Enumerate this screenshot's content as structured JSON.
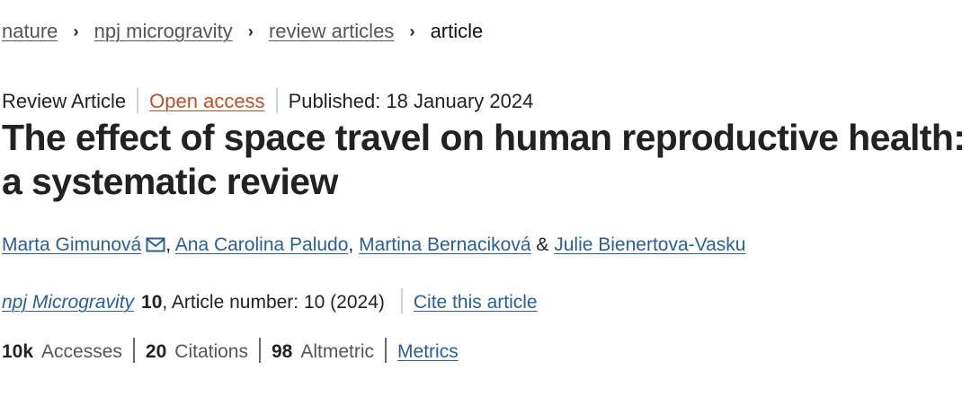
{
  "breadcrumb": {
    "items": [
      "nature",
      "npj microgravity",
      "review articles"
    ],
    "current": "article",
    "separator": "›"
  },
  "meta": {
    "type": "Review Article",
    "access": "Open access",
    "published": "Published: 18 January 2024"
  },
  "title": "The effect of space travel on human reproductive health: a systematic review",
  "authors": {
    "list": [
      "Marta Gimunová",
      "Ana Carolina Paludo",
      "Martina Bernaciková",
      "Julie Bienertova-Vasku"
    ],
    "comma": ",",
    "ampersand": "&",
    "contact_icon": "mail-icon"
  },
  "journal": {
    "name": "npj Microgravity",
    "volume": "10",
    "article_number": ", Article number: 10 (2024)",
    "cite": "Cite this article"
  },
  "metrics": {
    "accesses_value": "10k",
    "accesses_label": "Accesses",
    "citations_value": "20",
    "citations_label": "Citations",
    "altmetric_value": "98",
    "altmetric_label": "Altmetric",
    "link": "Metrics"
  },
  "colors": {
    "link": "#2b5f91",
    "open_access": "#b9512a",
    "text": "#222222",
    "muted": "#555555",
    "divider": "#c8d3dc"
  }
}
